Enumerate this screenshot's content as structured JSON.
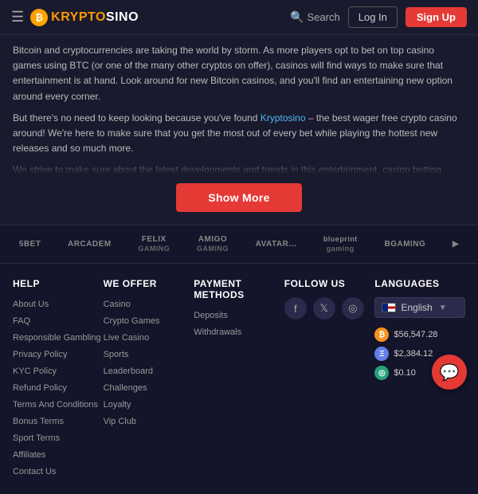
{
  "header": {
    "logo_text_start": "KRYPTO",
    "logo_text_end": "SINO",
    "search_label": "Search",
    "login_label": "Log In",
    "signup_label": "Sign Up"
  },
  "main": {
    "para1": "Bitcoin and cryptocurrencies are taking the world by storm. As more players opt to bet on top casino games using BTC (or one of the many other cryptos on offer), casinos will find ways to make sure that entertainment is at hand. Look around for new Bitcoin casinos, and you'll find an entertaining new option around every corner.",
    "para2_before_link": "But there's no need to keep looking because you've found ",
    "link_text": "Kryptosino",
    "para2_after_link": " – the best wager free crypto casino around! We're here to make sure that you get the most out of every bet while playing the hottest new releases and so much more.",
    "fade_text": "We strive to make sure about the latest developments and trends in this entertainment, casino betting...",
    "show_more_label": "Show More"
  },
  "providers": [
    {
      "name": "5BET",
      "sub": ""
    },
    {
      "name": "ARCADEM",
      "sub": ""
    },
    {
      "name": "FELIX\nGAMING",
      "sub": ""
    },
    {
      "name": "AMIGO\nGAMING",
      "sub": ""
    },
    {
      "name": "AVATAR...",
      "sub": ""
    },
    {
      "name": "blueprint\ngaming",
      "sub": ""
    },
    {
      "name": "BGAMING",
      "sub": ""
    },
    {
      "name": "...",
      "sub": ""
    }
  ],
  "footer": {
    "help": {
      "title": "HELP",
      "links": [
        "About Us",
        "FAQ",
        "Responsible Gambling",
        "Privacy Policy",
        "KYC Policy",
        "Refund Policy",
        "Terms And Conditions",
        "Bonus Terms",
        "Sport Terms",
        "Affiliates",
        "Contact Us"
      ]
    },
    "we_offer": {
      "title": "WE OFFER",
      "links": [
        "Casino",
        "Crypto Games",
        "Live Casino",
        "Sports",
        "Leaderboard",
        "Challenges",
        "Loyalty",
        "Vip Club"
      ]
    },
    "payment": {
      "title": "PAYMENT METHODS",
      "links": [
        "Deposits",
        "Withdrawals"
      ]
    },
    "follow": {
      "title": "FOLLOW US",
      "facebook": "f",
      "twitter": "𝕏",
      "instagram": "◎"
    },
    "languages": {
      "title": "LANGUAGES",
      "selected": "English"
    },
    "crypto": [
      {
        "symbol": "₿",
        "type": "btc",
        "amount": "$56,547.28"
      },
      {
        "symbol": "Ξ",
        "type": "eth",
        "amount": "$2,384.12"
      },
      {
        "symbol": "◎",
        "type": "other",
        "amount": "$0.10"
      }
    ]
  },
  "chat_icon": "💬"
}
